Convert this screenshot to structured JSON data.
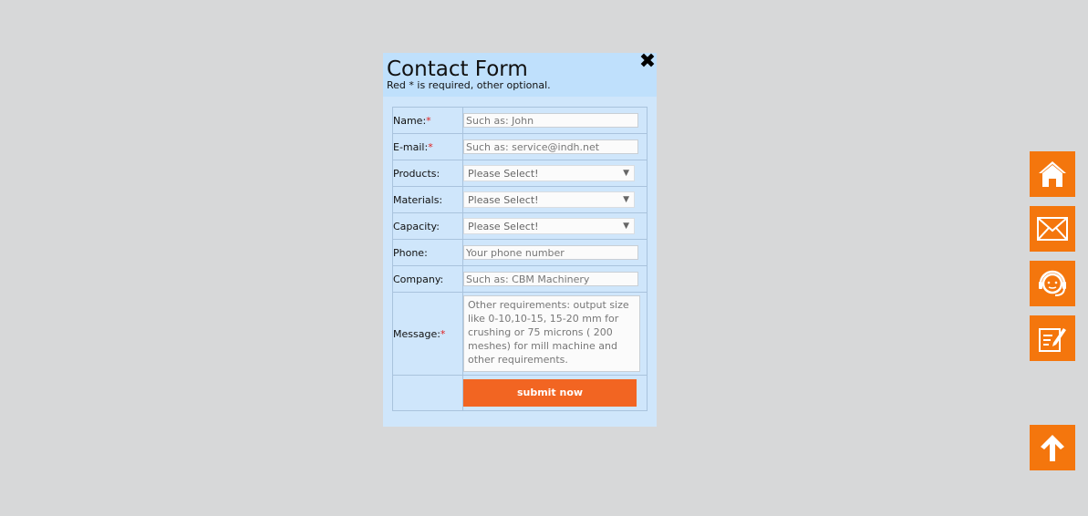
{
  "modal": {
    "title": "Contact Form",
    "subtitle": "Red * is required, other optional.",
    "close_icon": "✖"
  },
  "form": {
    "rows": [
      {
        "label": "Name:",
        "required": "*",
        "placeholder": "Such as: John"
      },
      {
        "label": "E-mail:",
        "required": "*",
        "placeholder": "Such as: service@indh.net"
      },
      {
        "label": "Products:",
        "value": "Please Select!"
      },
      {
        "label": "Materials:",
        "value": "Please Select!"
      },
      {
        "label": "Capacity:",
        "value": "Please Select!"
      },
      {
        "label": "Phone:",
        "placeholder": "Your phone number"
      },
      {
        "label": "Company:",
        "placeholder": "Such as: CBM Machinery"
      },
      {
        "label": "Message:",
        "required": "*",
        "placeholder": "Other requirements: output size like 0-10,10-15, 15-20 mm for crushing or 75 microns ( 200 meshes) for mill machine and other requirements."
      }
    ],
    "submit_label": "submit now"
  },
  "sidebar": {
    "buttons": [
      {
        "icon": "home-icon"
      },
      {
        "icon": "mail-icon"
      },
      {
        "icon": "support-headset-icon"
      },
      {
        "icon": "edit-note-icon"
      },
      {
        "icon": "arrow-up-icon"
      }
    ]
  },
  "colors": {
    "accent": "#f4760d",
    "submit": "#f26522",
    "modal_bg": "#cfe6fb",
    "modal_header": "#bfe0fc",
    "page_bg": "#d7d8d9"
  }
}
